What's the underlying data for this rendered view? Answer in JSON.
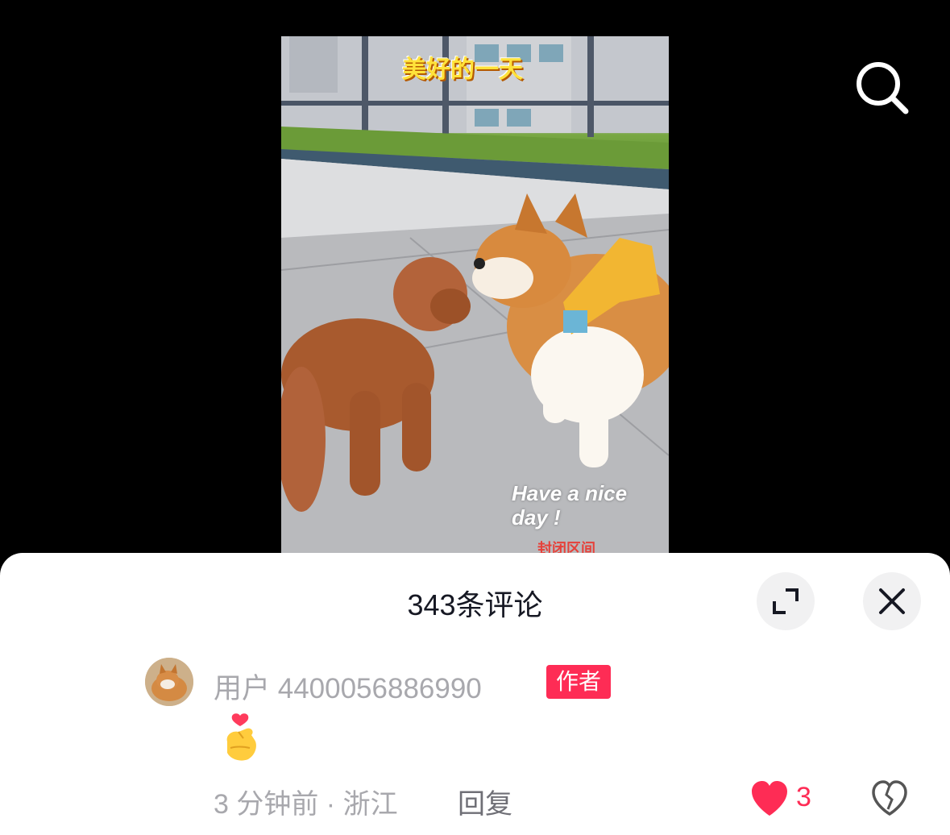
{
  "video": {
    "sticker_title": "美好的一天",
    "sticker_nice": "Have a nice day !",
    "sticker_caption": "封闭区间"
  },
  "icons": {
    "search": "search-icon",
    "expand": "expand-icon",
    "close": "close-icon",
    "like": "heart-icon",
    "dislike": "broken-heart-icon"
  },
  "comments_panel": {
    "title": "343条评论"
  },
  "comment": {
    "username": "用户 4400056886990",
    "badge": "作者",
    "content_emoji": "finger-heart-emoji",
    "time_location": "3 分钟前 · 浙江",
    "reply_label": "回复",
    "like_count": "3"
  },
  "colors": {
    "accent": "#fe2c55",
    "secondary_text": "#a8a8ad",
    "title_text": "#161823"
  }
}
